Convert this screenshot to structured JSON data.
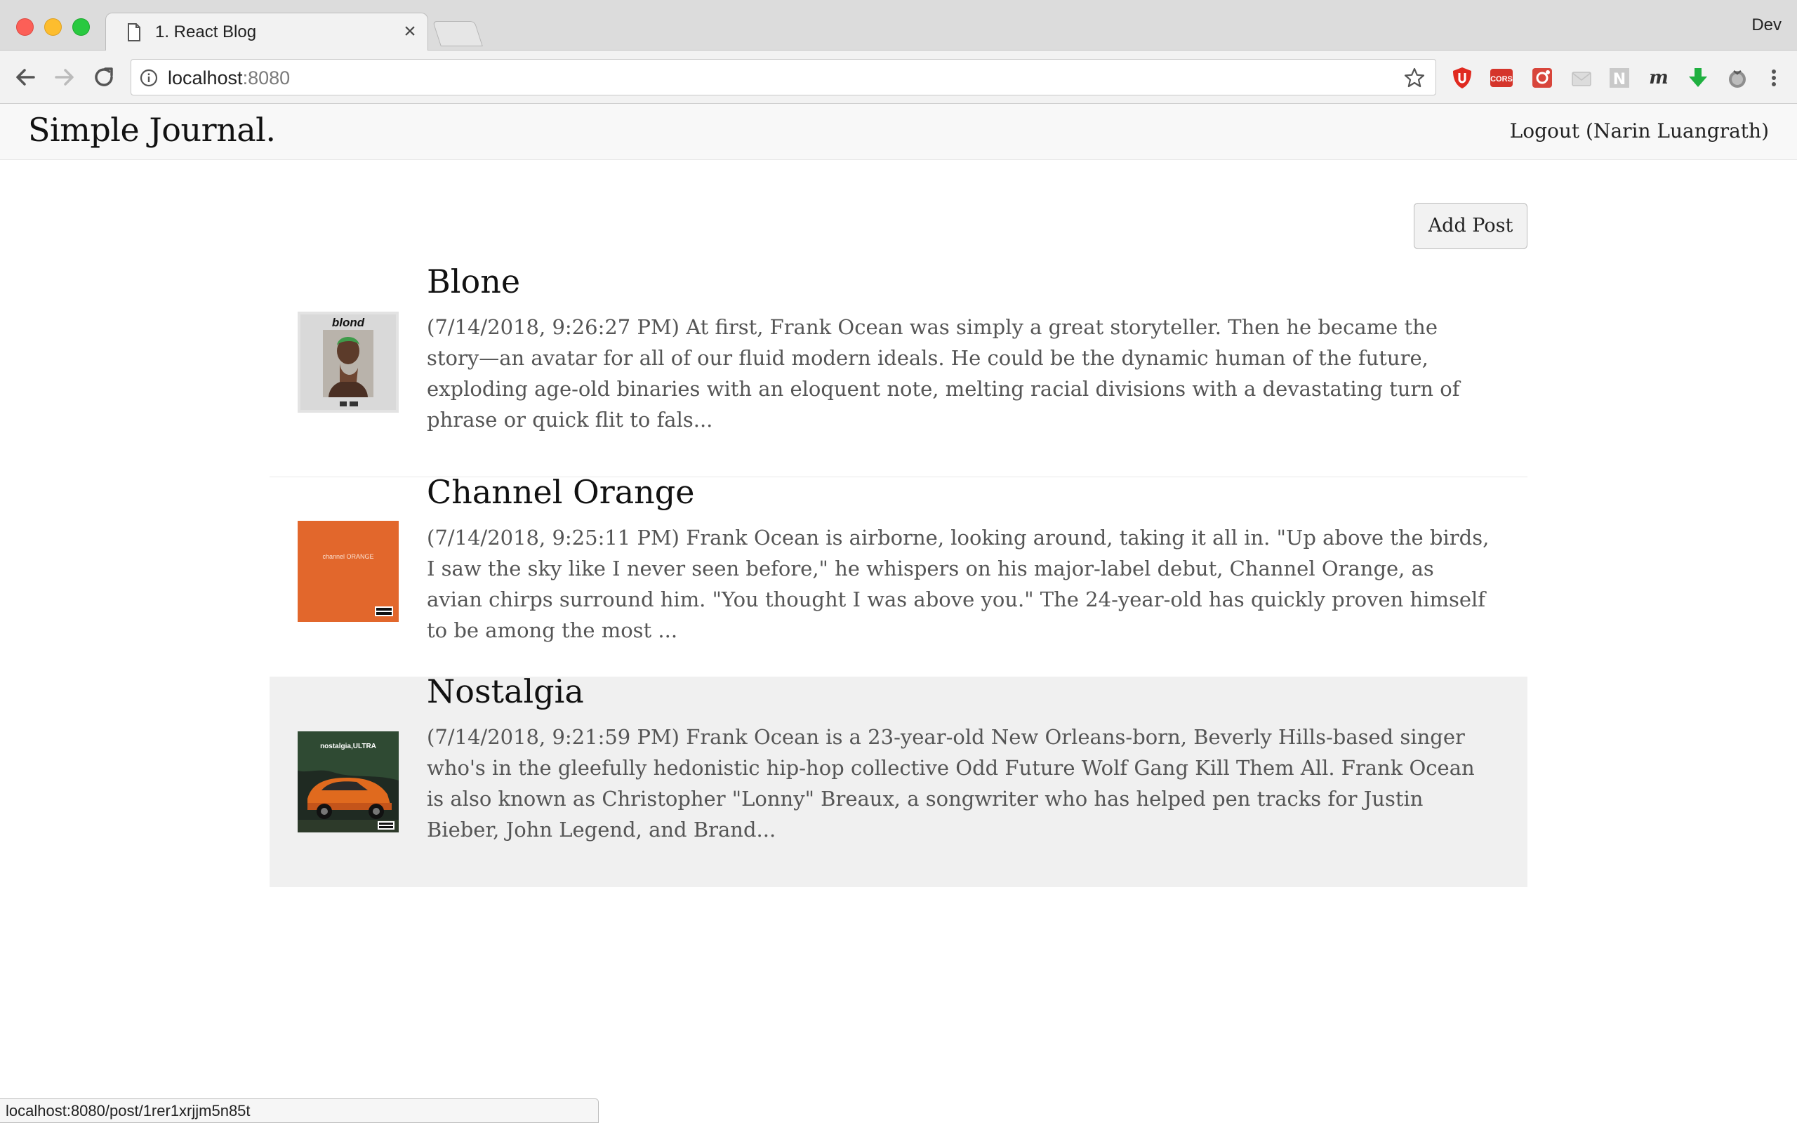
{
  "browser": {
    "tab_title": "1. React Blog",
    "tab_close": "×",
    "profile_name": "Dev",
    "url_host": "localhost",
    "url_port": ":8080",
    "status_url": "localhost:8080/post/1rer1xrjjm5n85t",
    "extensions": [
      "ublock-icon",
      "cors-icon",
      "screenshot-icon",
      "mail-icon",
      "notion-icon",
      "m-icon",
      "download-icon",
      "tomato-icon",
      "menu-icon"
    ]
  },
  "site": {
    "brand": "Simple Journal.",
    "logout": "Logout (Narin Luangrath)",
    "add_post": "Add Post"
  },
  "posts": [
    {
      "title": "Blone",
      "excerpt": "(7/14/2018, 9:26:27 PM) At first, Frank Ocean was simply a great storyteller. Then he became the story—an avatar for all of our fluid modern ideals. He could be the dynamic human of the future, exploding age-old binaries with an eloquent note, melting racial divisions with a devastating turn of phrase or quick flit to fals...",
      "cover_text": "blond"
    },
    {
      "title": "Channel Orange",
      "excerpt": "(7/14/2018, 9:25:11 PM) Frank Ocean is airborne, looking around, taking it all in. \"Up above the birds, I saw the sky like I never seen before,\" he whispers on his major-label debut, Channel Orange, as avian chirps surround him. \"You thought I was above you.\" The 24-year-old has quickly proven himself to be among the most ...",
      "cover_text": "channel ORANGE"
    },
    {
      "title": "Nostalgia",
      "excerpt": "(7/14/2018, 9:21:59 PM) Frank Ocean is a 23-year-old New Orleans-born, Beverly Hills-based singer who's in the gleefully hedonistic hip-hop collective Odd Future Wolf Gang Kill Them All. Frank Ocean is also known as Christopher \"Lonny\" Breaux, a songwriter who has helped pen tracks for Justin Bieber, John Legend, and Brand...",
      "cover_text": "nostalgia,ULTRA"
    }
  ],
  "colors": {
    "channel_orange": "#e2672c",
    "hover_row": "#f0f0f0"
  }
}
